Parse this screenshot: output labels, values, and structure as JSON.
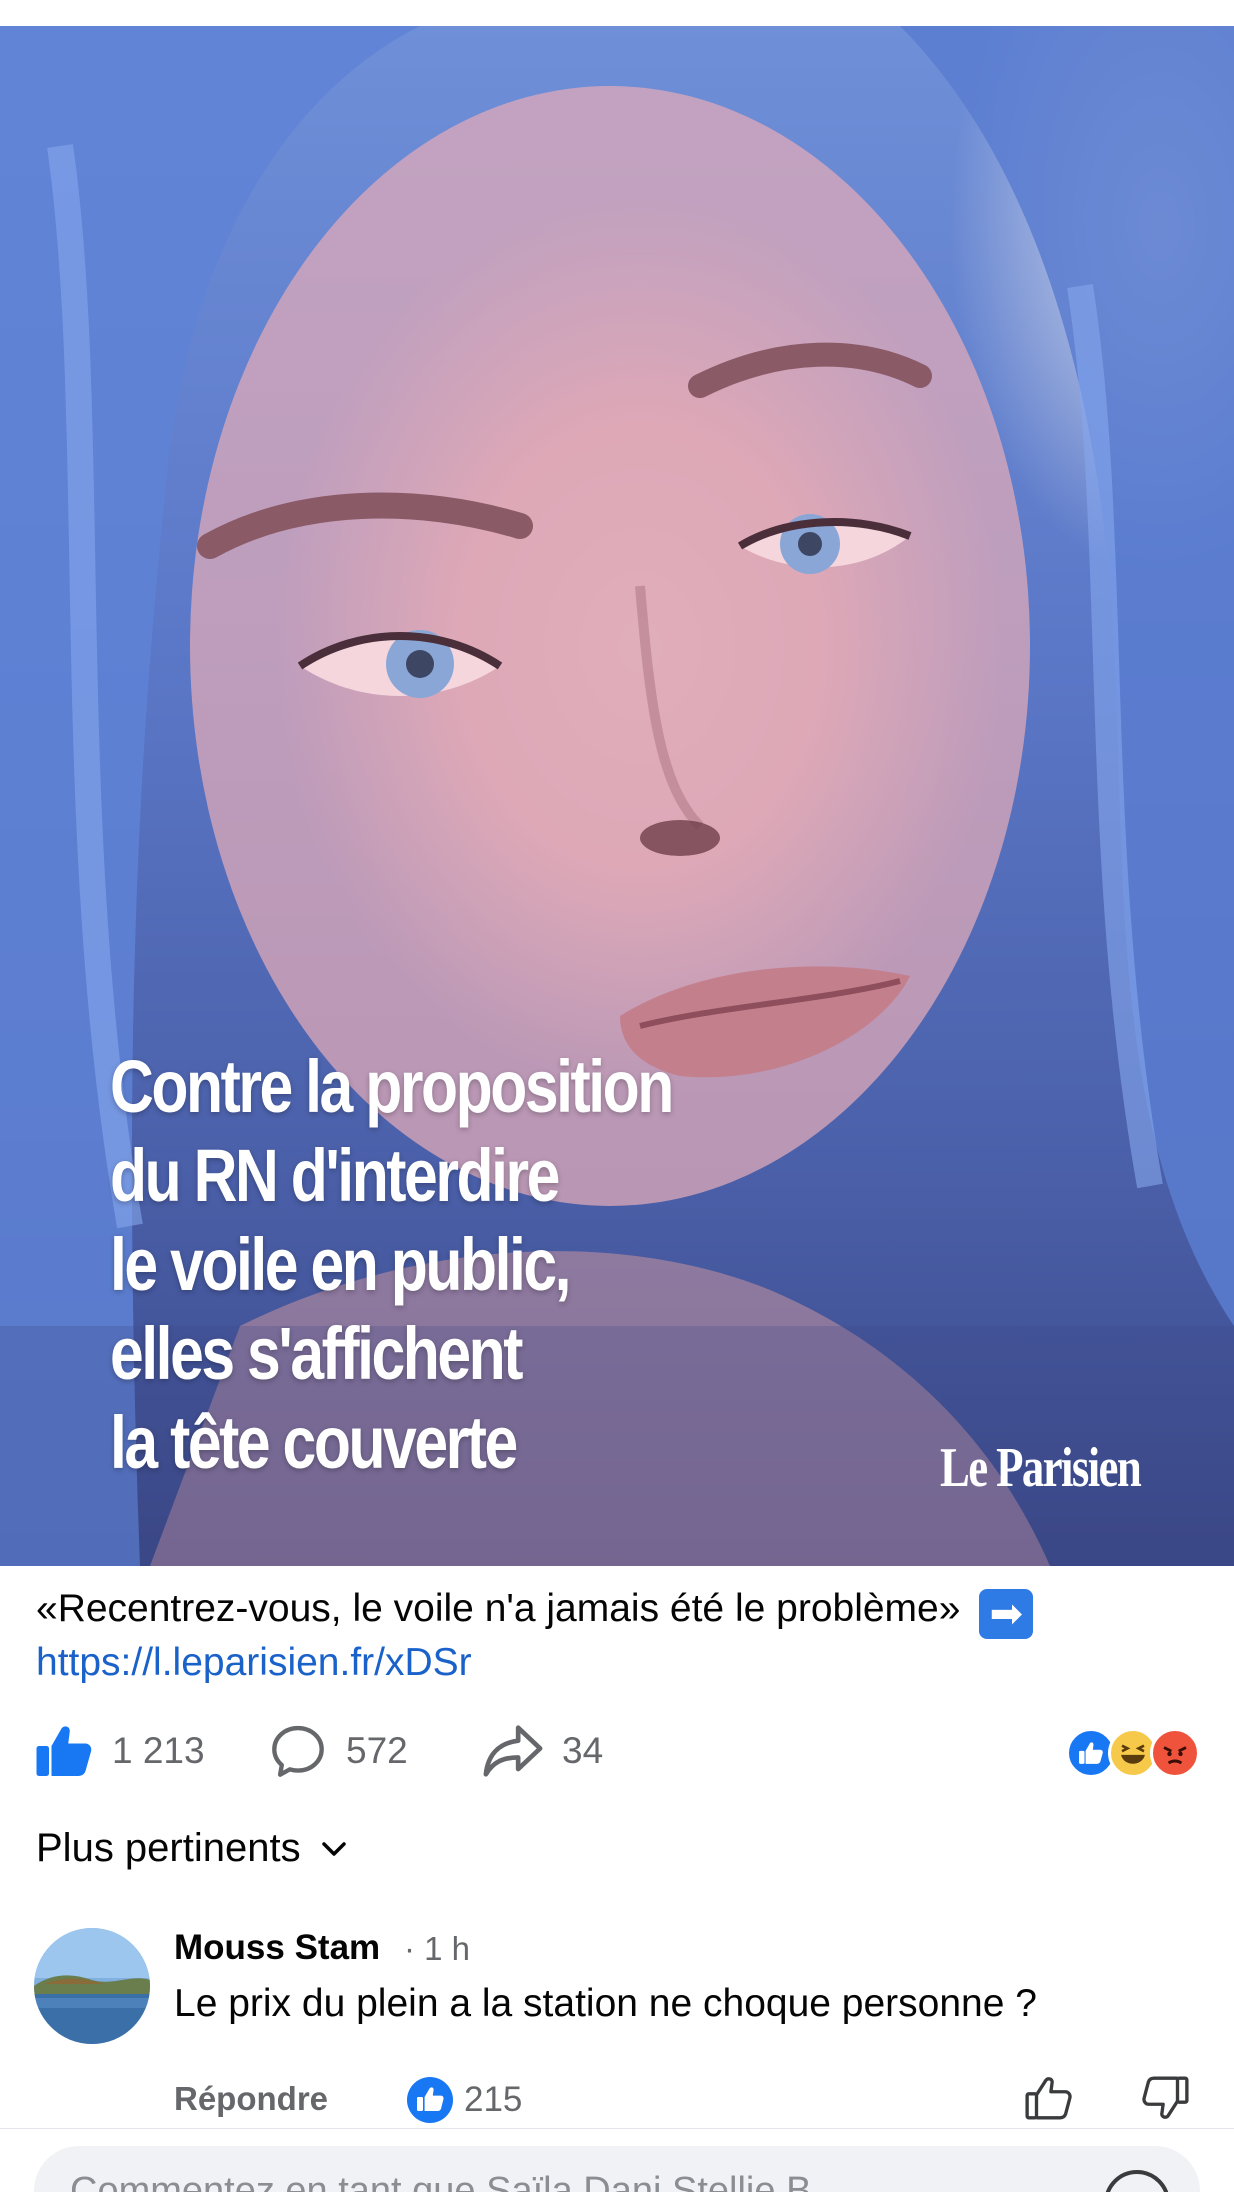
{
  "post": {
    "overlay_lines": [
      "Contre la proposition",
      "du RN d'interdire",
      "le voile en public,",
      "elles s'affichent",
      "la tête couverte"
    ],
    "brand": "Le Parisien",
    "caption": "«Recentrez-vous, le voile n'a jamais été le problème»",
    "caption_emoji": "➡",
    "link": "https://l.leparisien.fr/xDSr"
  },
  "actions": {
    "like_count": "1 213",
    "comment_count": "572",
    "share_count": "34",
    "reactions": [
      "like",
      "haha",
      "angry"
    ]
  },
  "comments": {
    "sort_label": "Plus pertinents",
    "items": [
      {
        "author": "Mouss Stam",
        "time": "· 1 h",
        "text": "Le prix du plein a la station ne choque personne ?",
        "reply_label": "Répondre",
        "likes": "215"
      }
    ]
  },
  "composer": {
    "placeholder": "Commentez en tant que Saïla Dani Stellie B..."
  },
  "colors": {
    "facebook_blue": "#1877f2",
    "link_blue": "#1a62c9",
    "muted_text": "#65676b",
    "haha_yellow": "#f7c94a",
    "angry_red": "#f0533c"
  }
}
